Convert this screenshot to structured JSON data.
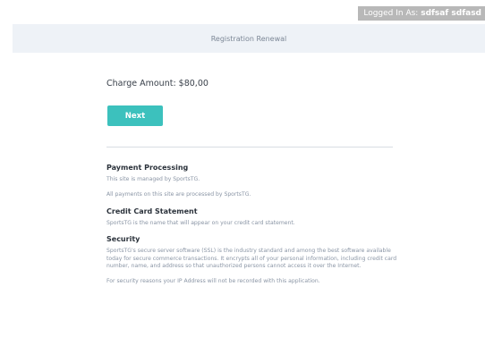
{
  "header": {
    "login_prefix": "Logged In As:",
    "login_user": "sdfsaf sdfasd"
  },
  "page": {
    "title": "Registration Renewal"
  },
  "charge": {
    "label": "Charge Amount: $80,00"
  },
  "actions": {
    "next_label": "Next"
  },
  "sections": {
    "payment": {
      "heading": "Payment Processing",
      "line1": "This site is managed by SportsTG.",
      "line2": "All payments on this site are processed by SportsTG."
    },
    "statement": {
      "heading": "Credit Card Statement",
      "line1": "SportsTG is the name that will appear on your credit card statement."
    },
    "security": {
      "heading": "Security",
      "line1": "SportsTG's secure server software (SSL) is the industry standard and among the best software available today for secure commerce transactions. It encrypts all of your personal information, including credit card number, name, and address so that unauthorized persons cannot access it over the Internet.",
      "line2": "For security reasons your IP Address will not be recorded with this application."
    }
  },
  "colors": {
    "accent": "#3cc1bd",
    "title_bar_bg": "#eef2f7",
    "login_bar_bg": "#b8b8b8",
    "muted_text": "#8a95a5"
  }
}
